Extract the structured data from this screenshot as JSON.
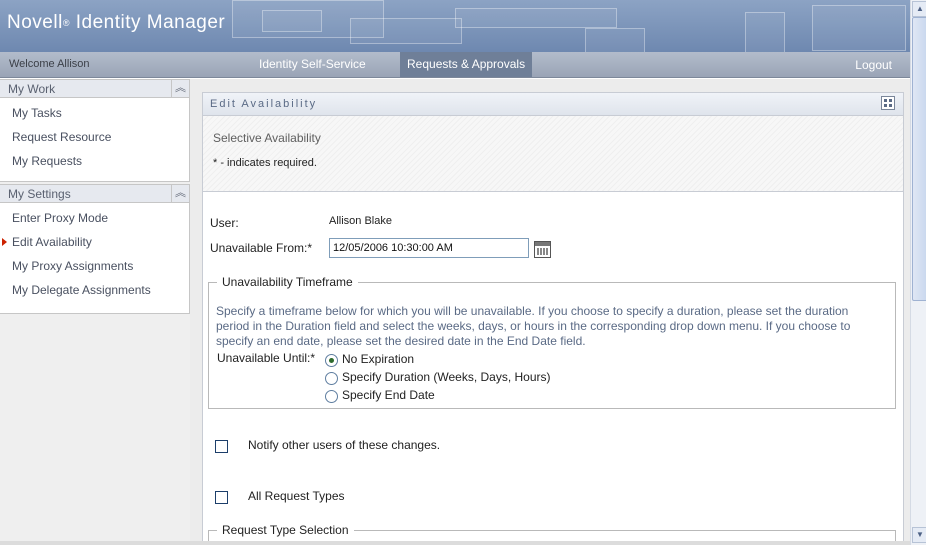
{
  "app": {
    "brand": "Novell",
    "brand_mark": "®",
    "product": "Identity Manager"
  },
  "navbar": {
    "welcome": "Welcome Allison",
    "tabs": [
      {
        "label": "Identity Self-Service",
        "active": false
      },
      {
        "label": "Requests & Approvals",
        "active": true
      }
    ],
    "logout": "Logout"
  },
  "sidebar": {
    "my_work": {
      "title": "My Work",
      "items": [
        "My Tasks",
        "Request Resource",
        "My Requests"
      ]
    },
    "my_settings": {
      "title": "My Settings",
      "items": [
        "Enter Proxy Mode",
        "Edit Availability",
        "My Proxy Assignments",
        "My Delegate Assignments"
      ],
      "selected": "Edit Availability"
    }
  },
  "content": {
    "title": "Edit Availability",
    "subtitle": "Selective Availability",
    "required_note": "* - indicates required.",
    "user_label": "User:",
    "user_value": "Allison Blake",
    "from_label": "Unavailable From:*",
    "from_value": "12/05/2006 10:30:00 AM",
    "timeframe": {
      "legend": "Unavailability Timeframe",
      "description": "Specify a timeframe below for which you will be unavailable. If you choose to specify a duration, please set the duration period in the Duration field and select the weeks, days, or hours in the corresponding drop down menu. If you choose to specify an end date, please set the desired date in the End Date field.",
      "until_label": "Unavailable Until:*",
      "options": [
        "No Expiration",
        "Specify Duration (Weeks, Days, Hours)",
        "Specify End Date"
      ],
      "selected": "No Expiration"
    },
    "notify_label": "Notify other users of these changes.",
    "all_types_label": "All Request Types",
    "request_type_legend": "Request Type Selection"
  },
  "colors": {
    "banner": "#6e88b0",
    "nav_active": "#6f7f98",
    "selected_arrow": "#cc2200",
    "description_text": "#5a6a85"
  }
}
